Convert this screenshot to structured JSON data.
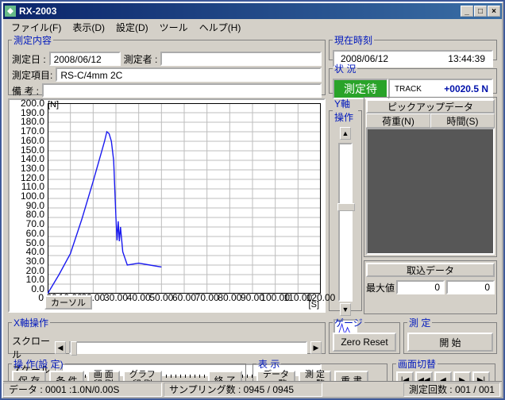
{
  "window": {
    "title": "RX-2003"
  },
  "menu": {
    "file": "ファイル(F)",
    "view": "表示(D)",
    "settings": "設定(D)",
    "tools": "ツール",
    "help": "ヘルプ(H)"
  },
  "measure": {
    "legend": "測定内容",
    "date_label": "測定日 :",
    "date_value": "2008/06/12",
    "operator_label": "測定者 :",
    "operator_value": "",
    "item_label": "測定項目:",
    "item_value": "RS-C/4mm 2C",
    "remarks_label": "備  考 :",
    "remarks_value": ""
  },
  "time": {
    "legend": "現在時刻",
    "date": "2008/06/12",
    "clock": "13:44:39"
  },
  "status": {
    "legend": "状  況",
    "label": "測定待",
    "track": "TRACK",
    "value": "+0020.5 N"
  },
  "yop": {
    "legend": "Y軸操作"
  },
  "pickup": {
    "legend": "ピックアップデータ",
    "col1": "荷重(N)",
    "col2": "時間(S)"
  },
  "importd": {
    "legend": "取込データ",
    "max_label": "最大値",
    "v1": "0",
    "v2": "0"
  },
  "xop": {
    "legend": "X軸操作",
    "scroll": "スクロール",
    "scale": "スケール"
  },
  "gauge": {
    "legend": "ゲージ",
    "zero": "Zero Reset"
  },
  "run": {
    "legend": "測  定",
    "start": "開  始"
  },
  "ops": {
    "legend": "操 作(設  定)",
    "save": "保 存",
    "cond": "条 件",
    "print": "画 面\n印 刷",
    "gprint": "グラフ\n印 刷",
    "exit": "終 了"
  },
  "disp": {
    "legend": "表  示",
    "dlist": "データ\n一  覧",
    "mlist": "測 定\n一 覧",
    "overlay": "重 書"
  },
  "screen": {
    "legend": "画面切替"
  },
  "statusbar": {
    "data": "データ  : 0001 :1.0N/0.00S",
    "sampling": "サンプリング数 :   0945 / 0945",
    "count": "測定回数 :   001 / 001"
  },
  "chart": {
    "cursor_btn": "カーソル",
    "unit_y": "[N]",
    "unit_x": "[S]"
  },
  "chart_data": {
    "type": "line",
    "title": "",
    "xlabel": "[S]",
    "ylabel": "[N]",
    "xlim": [
      0,
      120
    ],
    "ylim": [
      0,
      200
    ],
    "xticks": [
      0,
      10,
      20,
      30,
      40,
      50,
      60,
      70,
      80,
      90,
      100,
      110,
      120
    ],
    "yticks": [
      0,
      10,
      20,
      30,
      40,
      50,
      60,
      70,
      80,
      90,
      100,
      110,
      120,
      130,
      140,
      150,
      160,
      170,
      180,
      190,
      200
    ],
    "series": [
      {
        "name": "荷重",
        "x": [
          0,
          5,
          10,
          15,
          20,
          25,
          26,
          27,
          28,
          29,
          30,
          30.5,
          31,
          31.5,
          32,
          33,
          35,
          40,
          45,
          50
        ],
        "y": [
          0,
          20,
          42,
          78,
          118,
          160,
          170,
          168,
          160,
          140,
          80,
          56,
          76,
          55,
          70,
          44,
          30,
          32,
          30,
          28
        ]
      }
    ]
  }
}
